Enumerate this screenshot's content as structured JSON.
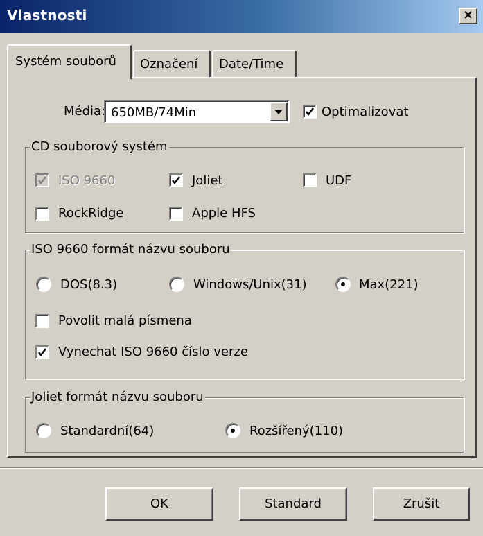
{
  "window": {
    "title": "Vlastnosti",
    "close_label": "×"
  },
  "tabs": [
    {
      "label": "Systém souborů",
      "active": true
    },
    {
      "label": "Označení",
      "active": false
    },
    {
      "label": "Date/Time",
      "active": false
    }
  ],
  "media": {
    "label": "Média:",
    "selected": "650MB/74Min",
    "optimize_label": "Optimalizovat",
    "optimize_checked": true
  },
  "cd_fs": {
    "title": "CD souborový systém",
    "options": [
      {
        "label": "ISO 9660",
        "checked": true,
        "disabled": true
      },
      {
        "label": "Joliet",
        "checked": true,
        "disabled": false
      },
      {
        "label": "UDF",
        "checked": false,
        "disabled": false
      },
      {
        "label": "RockRidge",
        "checked": false,
        "disabled": false
      },
      {
        "label": "Apple HFS",
        "checked": false,
        "disabled": false
      }
    ]
  },
  "iso_format": {
    "title": "ISO 9660 formát názvu souboru",
    "radios": [
      {
        "label": "DOS(8.3)",
        "selected": false
      },
      {
        "label": "Windows/Unix(31)",
        "selected": false
      },
      {
        "label": "Max(221)",
        "selected": true
      }
    ],
    "lowercase_label": "Povolit malá písmena",
    "lowercase_checked": false,
    "omit_version_label": "Vynechat ISO 9660 číslo verze",
    "omit_version_checked": true
  },
  "joliet_format": {
    "title": "Joliet formát názvu souboru",
    "radios": [
      {
        "label": "Standardní(64)",
        "selected": false
      },
      {
        "label": "Rozšířený(110)",
        "selected": true
      }
    ]
  },
  "buttons": {
    "ok": "OK",
    "standard": "Standard",
    "cancel": "Zrušit"
  }
}
